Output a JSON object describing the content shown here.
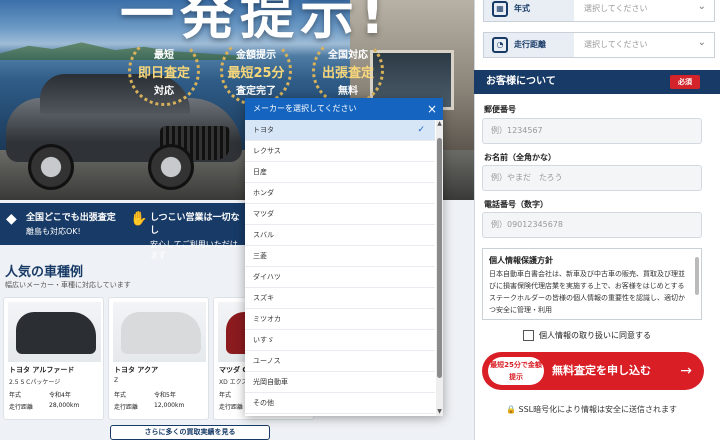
{
  "hero": {
    "title": "一発提示!",
    "badges": [
      {
        "line1": "最短",
        "line2": "即日査定",
        "line3": "対応"
      },
      {
        "line1": "金額提示",
        "line2": "最短25分",
        "line3": "査定完了"
      },
      {
        "line1": "全国対応",
        "line2": "出張査定",
        "line3": "無料"
      }
    ]
  },
  "features": [
    {
      "title": "全国どこでも出張査定",
      "sub": "離島も対応OK!"
    },
    {
      "title": "しつこい営業は一切なし",
      "sub": "安心してご利用いただけます"
    }
  ],
  "popular": {
    "title": "人気の車種例",
    "subtitle": "幅広いメーカー・車種に対応しています",
    "cards": [
      {
        "name": "トヨタ アルファード",
        "grade": "2.5 S Cパッケージ",
        "year_label": "年式",
        "year": "令和4年",
        "mileage_label": "走行距離",
        "mileage": "28,000km",
        "color": "#2b2e33"
      },
      {
        "name": "トヨタ アクア",
        "grade": "Z",
        "year_label": "年式",
        "year": "令和5年",
        "mileage_label": "走行距離",
        "mileage": "12,000km",
        "color": "#d8dadc"
      },
      {
        "name": "マツダ CX-5",
        "grade": "XD エクスク",
        "year_label": "年式",
        "year": "",
        "mileage_label": "走行距離",
        "mileage": "",
        "color": "#8b1b1f"
      }
    ],
    "more_button": "さらに多くの買取実績を見る"
  },
  "form": {
    "year": {
      "label": "年式",
      "placeholder": "選択してください"
    },
    "mileage": {
      "label": "走行距離",
      "placeholder": "選択してください"
    },
    "customer_header": "お客様について",
    "required_badge": "必須",
    "postal": {
      "label": "郵便番号",
      "placeholder": "例）1234567"
    },
    "name": {
      "label": "お名前（全角かな）",
      "placeholder": "例）やまだ　たろう"
    },
    "phone": {
      "label": "電話番号（数字）",
      "placeholder": "例）09012345678"
    },
    "privacy": {
      "title": "個人情報保護方針",
      "body": "日本自動車白書会社は、新車及び中古車の販売、買取及び理並びに損害保険代理店業を実施する上で、お客様をはじめとするステークホルダーの皆様の個人情報の重要性を認識し、適切かつ安全に管理・利用"
    },
    "agree": "個人情報の取り扱いに同意する",
    "submit_small": "最短25分で金額提示",
    "submit_main": "無料査定を申し込む",
    "submit_arrow": "→",
    "ssl": "SSL暗号化により情報は安全に送信されます"
  },
  "dropdown": {
    "title": "メーカーを選択してください",
    "close": "×",
    "selected": "トヨタ",
    "options": [
      "トヨタ",
      "レクサス",
      "日産",
      "ホンダ",
      "マツダ",
      "スバル",
      "三菱",
      "ダイハツ",
      "スズキ",
      "ミツオカ",
      "いすゞ",
      "ユーノス",
      "光岡自動車",
      "その他"
    ]
  },
  "colors": {
    "navy": "#173a66",
    "red": "#d91e26",
    "blue": "#1565c0"
  }
}
